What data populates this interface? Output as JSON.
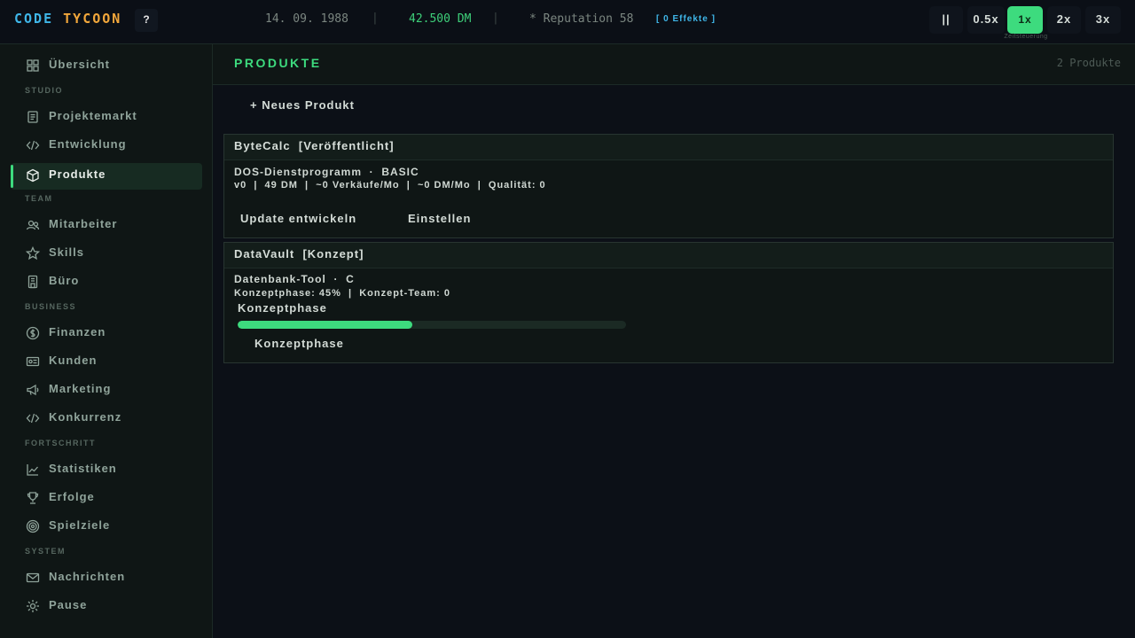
{
  "topbar": {
    "logo_part1": "CODE",
    "logo_part2": "TYCOON",
    "help_label": "?",
    "date": "14. 09. 1988",
    "separator": "|",
    "money": "42.500 DM",
    "reputation": "* Reputation 58",
    "effects": "[ 0 Effekte ]",
    "pause_label": "||",
    "speeds": [
      {
        "label": "0.5x",
        "active": false
      },
      {
        "label": "1x",
        "active": true
      },
      {
        "label": "2x",
        "active": false
      },
      {
        "label": "3x",
        "active": false
      }
    ],
    "speed_caption": "Zeitsteuerung"
  },
  "sidebar": {
    "items": [
      {
        "label": "Übersicht",
        "icon": "grid-icon"
      },
      {
        "section": "STUDIO"
      },
      {
        "label": "Projektemarkt",
        "icon": "document-icon"
      },
      {
        "label": "Entwicklung",
        "icon": "code-icon"
      },
      {
        "label": "Produkte",
        "icon": "box-icon",
        "active": true
      },
      {
        "section": "TEAM"
      },
      {
        "label": "Mitarbeiter",
        "icon": "people-icon"
      },
      {
        "label": "Skills",
        "icon": "star-icon"
      },
      {
        "label": "Büro",
        "icon": "building-icon"
      },
      {
        "section": "BUSINESS"
      },
      {
        "label": "Finanzen",
        "icon": "coin-icon"
      },
      {
        "label": "Kunden",
        "icon": "id-card-icon"
      },
      {
        "label": "Marketing",
        "icon": "megaphone-icon"
      },
      {
        "label": "Konkurrenz",
        "icon": "code-icon"
      },
      {
        "section": "FORTSCHRITT"
      },
      {
        "label": "Statistiken",
        "icon": "chart-icon"
      },
      {
        "label": "Erfolge",
        "icon": "trophy-icon"
      },
      {
        "label": "Spielziele",
        "icon": "target-icon"
      },
      {
        "section": "SYSTEM"
      },
      {
        "label": "Nachrichten",
        "icon": "mail-icon"
      },
      {
        "label": "Pause",
        "icon": "gear-icon"
      }
    ]
  },
  "main": {
    "title": "PRODUKTE",
    "count": "2 Produkte",
    "new_product_label": "+ Neues Produkt",
    "products": [
      {
        "title": "ByteCalc  [Veröffentlicht]",
        "subtitle": "DOS-Dienstprogramm  ·  BASIC",
        "stats": "v0  |  49 DM  |  ~0 Verkäufe/Mo  |  ~0 DM/Mo  |  Qualität: 0",
        "update_button": "Update entwickeln",
        "settings_button": "Einstellen"
      },
      {
        "title": "DataVault  [Konzept]",
        "subtitle": "Datenbank-Tool  ·  C",
        "stats": "Konzeptphase: 45%  |  Konzept-Team: 0",
        "phase_label": "Konzeptphase",
        "progress": 0.45,
        "phase_button": "Konzeptphase"
      }
    ]
  },
  "colors": {
    "accent": "#3ddb7e",
    "logo_blue": "#3fb6e8",
    "logo_orange": "#f2a73b"
  }
}
